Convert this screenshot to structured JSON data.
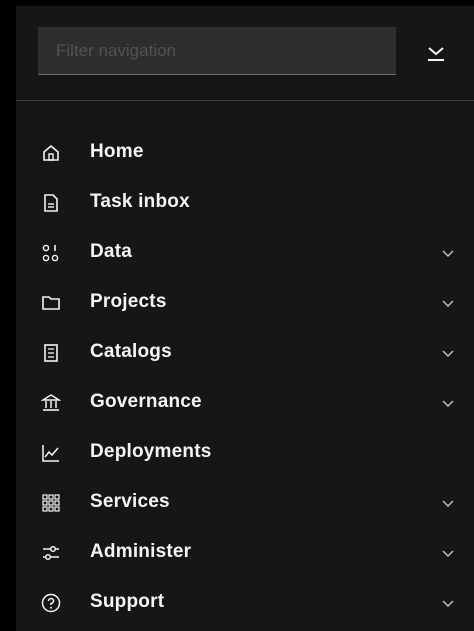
{
  "filter": {
    "placeholder": "Filter navigation",
    "value": ""
  },
  "nav": {
    "items": [
      {
        "label": "Home",
        "icon": "home-icon",
        "expandable": false
      },
      {
        "label": "Task inbox",
        "icon": "document-icon",
        "expandable": false
      },
      {
        "label": "Data",
        "icon": "data-icon",
        "expandable": true
      },
      {
        "label": "Projects",
        "icon": "folder-icon",
        "expandable": true
      },
      {
        "label": "Catalogs",
        "icon": "catalog-icon",
        "expandable": true
      },
      {
        "label": "Governance",
        "icon": "bank-icon",
        "expandable": true
      },
      {
        "label": "Deployments",
        "icon": "chart-line-icon",
        "expandable": false
      },
      {
        "label": "Services",
        "icon": "grid-icon",
        "expandable": true
      },
      {
        "label": "Administer",
        "icon": "settings-adjust-icon",
        "expandable": true
      },
      {
        "label": "Support",
        "icon": "help-icon",
        "expandable": true
      }
    ]
  },
  "colors": {
    "panel": "#161616",
    "text": "#f4f4f4",
    "icon": "#f4f4f4",
    "chevron": "#c6c6c6",
    "input_bg": "#2e2e2e",
    "divider": "#393939"
  }
}
